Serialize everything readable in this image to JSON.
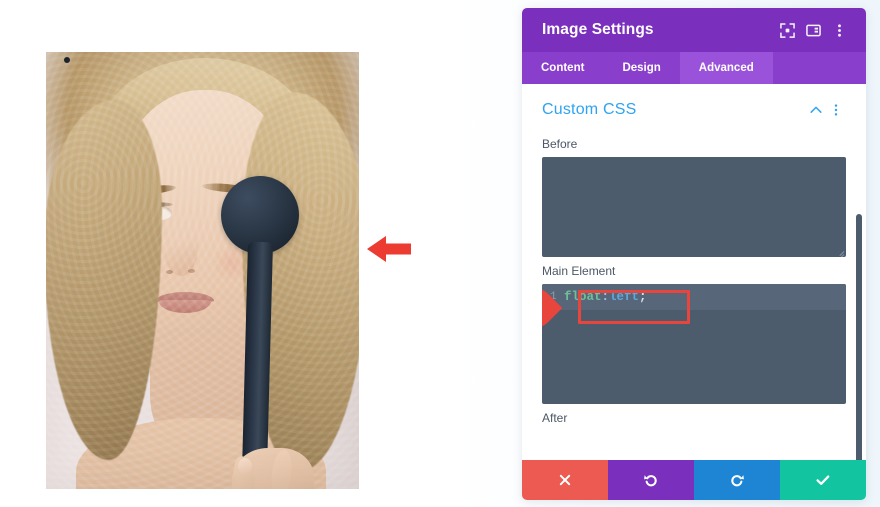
{
  "photo": {
    "alt_description": "Woman with curly blonde hair holding a dark navy spoon over one eye",
    "icon": "portrait-photo"
  },
  "annotations": {
    "arrow": {
      "icon": "left-arrow-icon",
      "color": "#ec3b31"
    },
    "callout": {
      "number": "1",
      "color": "#e8453c"
    },
    "highlight_color": "#e8453c"
  },
  "panel": {
    "header": {
      "title": "Image Settings",
      "icons": [
        {
          "name": "focus-target-icon"
        },
        {
          "name": "layout-panel-icon"
        },
        {
          "name": "more-vertical-icon"
        }
      ]
    },
    "tabs": [
      {
        "label": "Content",
        "active": false
      },
      {
        "label": "Design",
        "active": false
      },
      {
        "label": "Advanced",
        "active": true
      }
    ],
    "section": {
      "title": "Custom CSS",
      "collapse_icon": "chevron-up-icon",
      "menu_icon": "more-vertical-icon",
      "accent_color": "#2ea3f2"
    },
    "fields": [
      {
        "label": "Before",
        "value": "",
        "placeholder": ""
      },
      {
        "label": "Main Element",
        "value": "float:left;",
        "placeholder": ""
      },
      {
        "label": "After",
        "value": "",
        "placeholder": ""
      }
    ],
    "code": {
      "line_number": "1",
      "property": "float",
      "colon": ":",
      "value": "left",
      "semicolon": ";"
    },
    "actions": [
      {
        "name": "cancel",
        "icon": "close-icon",
        "color": "#ec5a52"
      },
      {
        "name": "undo",
        "icon": "undo-icon",
        "color": "#7b2fbd"
      },
      {
        "name": "redo",
        "icon": "redo-icon",
        "color": "#1e85d4"
      },
      {
        "name": "save",
        "icon": "check-icon",
        "color": "#12c5a0"
      }
    ]
  }
}
